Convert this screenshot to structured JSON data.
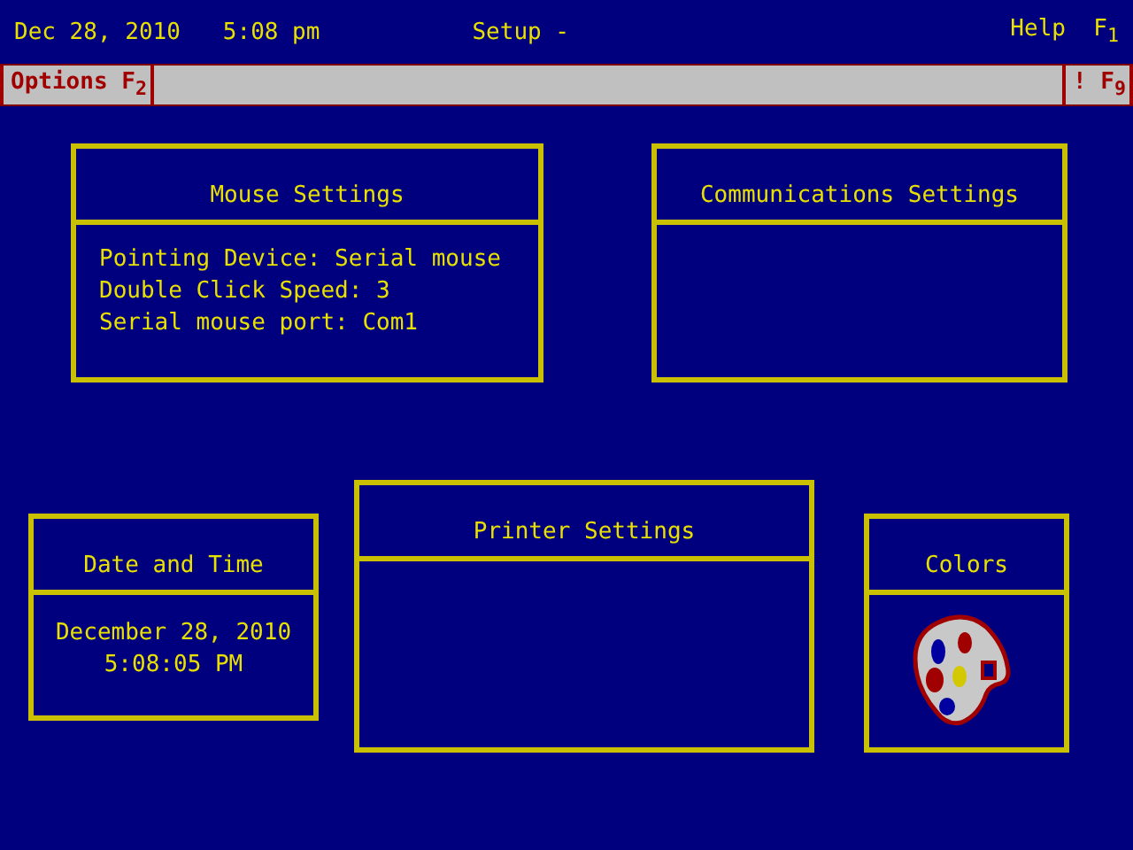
{
  "top_bar": {
    "date": "Dec 28, 2010",
    "time": "5:08 pm",
    "title": "Setup -",
    "help": {
      "label": "Help",
      "key": "F$_{1}$"
    }
  },
  "menu_bar": {
    "options": {
      "label": "Options",
      "key": "F$_{2}$"
    },
    "run": {
      "label": "!",
      "key": "F$_{9}$"
    }
  },
  "panels": [
    {
      "title": "Mouse Settings",
      "kind": "details",
      "lines": [
        "Pointing Device: Serial mouse",
        "Double Click Speed: 3",
        "Serial mouse port: Com1"
      ]
    },
    {
      "title": "Communications Settings",
      "kind": "blank"
    },
    {
      "title": "Date and Time",
      "kind": "clock",
      "lines": [
        "December 28, 2010",
        "5:08:05 PM"
      ]
    },
    {
      "title": "Printer Settings",
      "kind": "blank"
    },
    {
      "title": "Colors",
      "kind": "palette"
    }
  ]
}
